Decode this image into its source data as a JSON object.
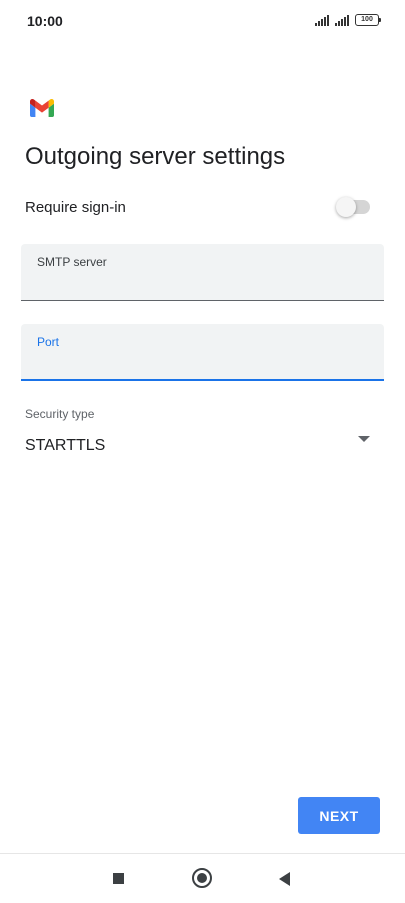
{
  "status_bar": {
    "time": "10:00",
    "battery": "100",
    "icons": [
      "signal-icon",
      "signal-icon",
      "battery-icon"
    ]
  },
  "app": {
    "logo": "gmail-logo"
  },
  "page": {
    "title": "Outgoing server settings"
  },
  "require_signin": {
    "label": "Require sign-in",
    "enabled": false
  },
  "fields": {
    "smtp": {
      "label": "SMTP server",
      "value": ""
    },
    "port": {
      "label": "Port",
      "value": ""
    }
  },
  "security": {
    "label": "Security type",
    "value": "STARTTLS"
  },
  "actions": {
    "next_label": "NEXT"
  },
  "colors": {
    "accent": "#1a73e8",
    "button": "#4285f4",
    "field_bg": "#f1f3f4"
  },
  "nav_bar": {
    "icons": [
      "recents-icon",
      "home-icon",
      "back-icon"
    ]
  }
}
